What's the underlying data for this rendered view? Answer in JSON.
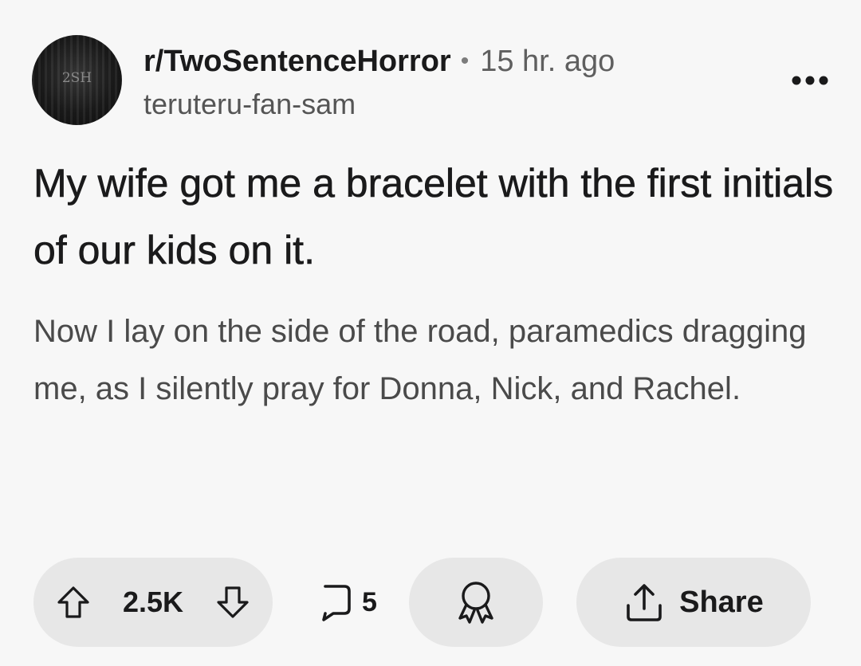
{
  "post": {
    "subreddit": "r/TwoSentenceHorror",
    "separator": "•",
    "time_ago": "15 hr. ago",
    "author": "teruteru-fan-sam",
    "avatar_text": "2SH",
    "title": "My wife got me a bracelet with the first initials of our kids on it.",
    "body": "Now I lay on the side of the road, paramedics dragging me, as I silently pray for Donna, Nick, and Rachel."
  },
  "actions": {
    "vote_count": "2.5K",
    "comment_count": "5",
    "share_label": "Share"
  },
  "icons": {
    "more": "more-options-icon",
    "upvote": "upvote-arrow-icon",
    "downvote": "downvote-arrow-icon",
    "comment": "comment-bubble-icon",
    "award": "award-ribbon-icon",
    "share": "share-upload-icon"
  },
  "colors": {
    "background": "#f7f7f7",
    "pill": "#e7e7e7",
    "text_primary": "#1a1a1b",
    "text_secondary": "#4a4a4a"
  }
}
